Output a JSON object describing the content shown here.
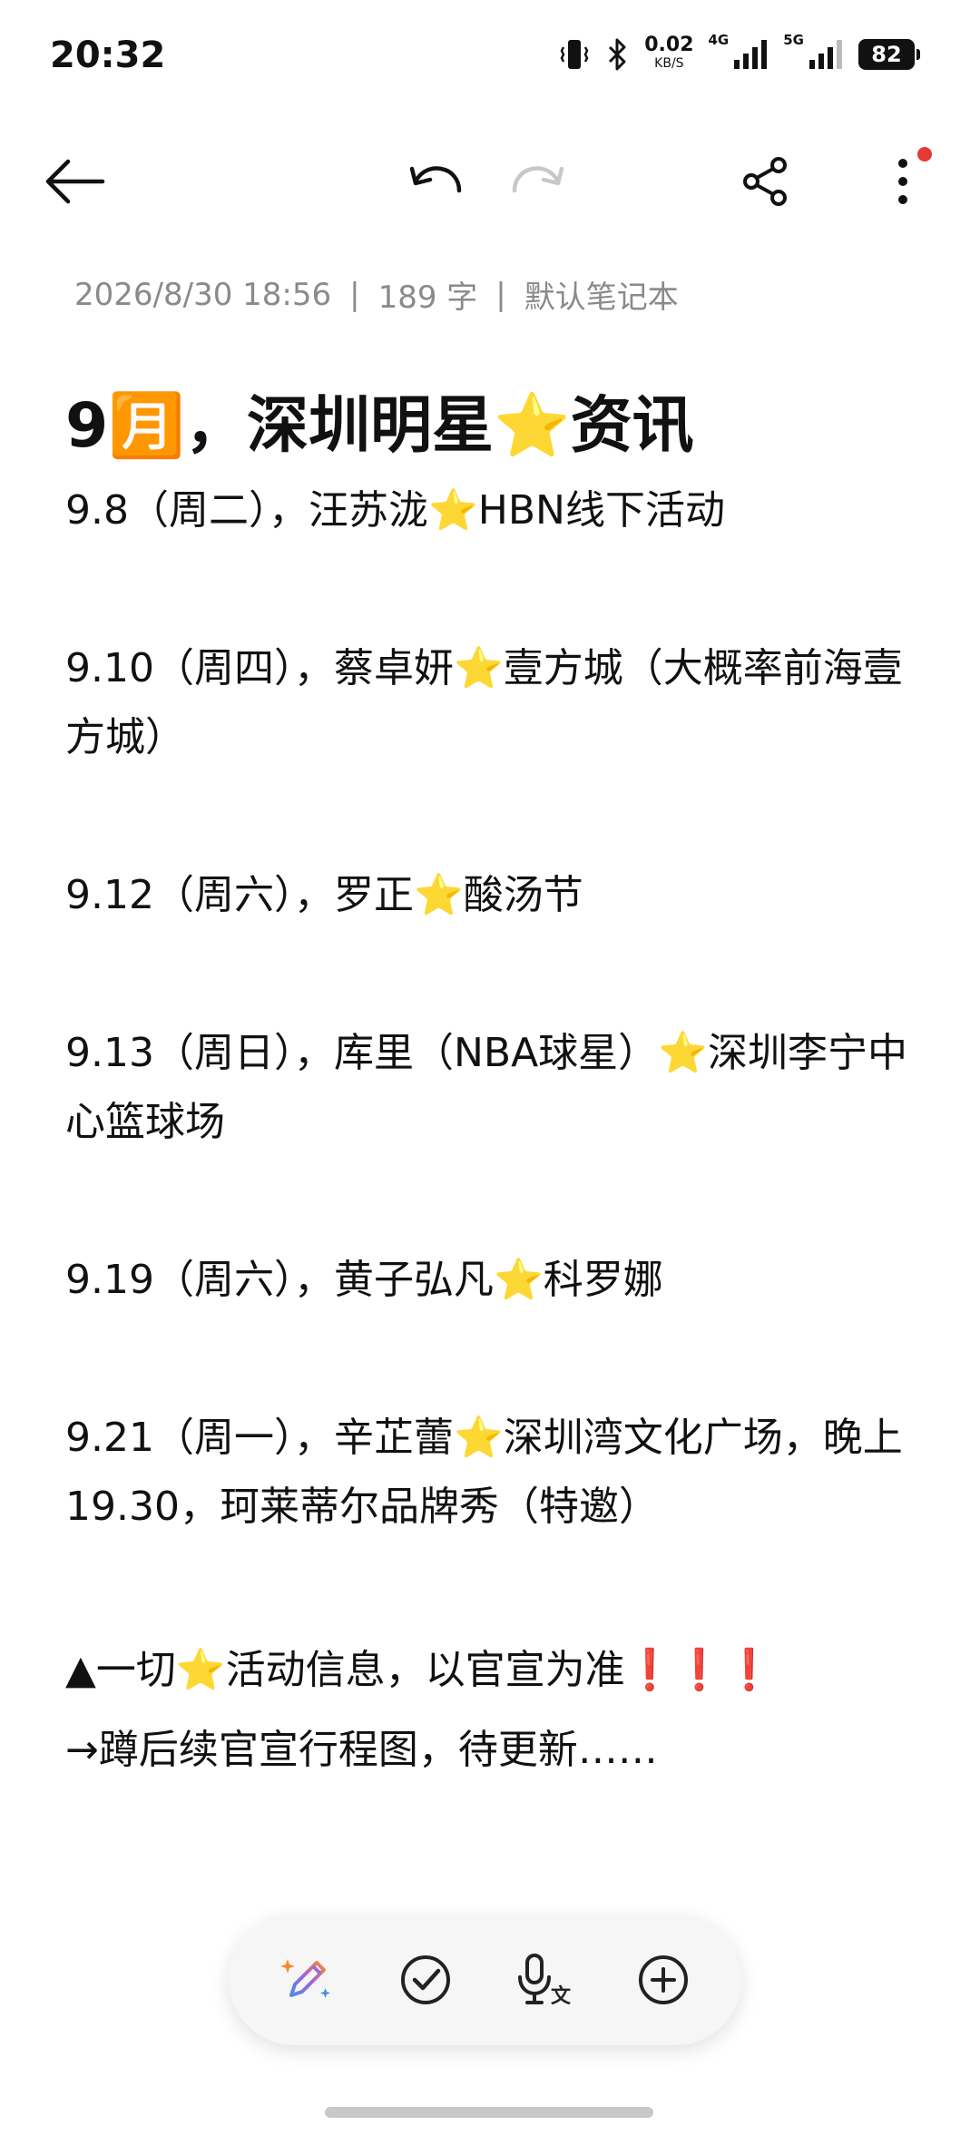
{
  "status_bar": {
    "time": "20:32",
    "net_speed_value": "0.02",
    "net_speed_unit": "KB/S",
    "signal1_label": "4G",
    "signal2_label": "5G",
    "battery": "82"
  },
  "meta": {
    "date": "2026/8/30 18:56",
    "separator": "|",
    "word_count": "189 字",
    "notebook": "默认笔记本"
  },
  "note": {
    "title": "9🈷️，深圳明星⭐资讯",
    "lines": [
      "9.8（周二），汪苏泷⭐HBN线下活动",
      "9.10（周四），蔡卓妍⭐壹方城（大概率前海壹方城）",
      "9.12（周六），罗正⭐酸汤节",
      "9.13（周日），库里（NBA球星）⭐深圳李宁中心篮球场",
      "9.19（周六），黄子弘凡⭐科罗娜",
      "9.21（周一），辛芷蕾⭐深圳湾文化广场，晚上19.30，珂莱蒂尔品牌秀（特邀）",
      "▲一切⭐活动信息，以官宣为准❗❗❗",
      "→蹲后续官宣行程图，待更新……"
    ]
  },
  "icons": {
    "back": "arrow-left-icon",
    "undo": "undo-icon",
    "redo": "redo-icon",
    "share": "share-icon",
    "more": "more-vertical-icon",
    "ai_pen": "ai-pen-icon",
    "checklist": "check-circle-icon",
    "voice": "voice-to-text-icon",
    "add": "plus-circle-icon"
  },
  "colors": {
    "more_badge": "#e53935",
    "meta_text": "#8a8a8a",
    "redo_disabled": "#c8c8c8"
  }
}
